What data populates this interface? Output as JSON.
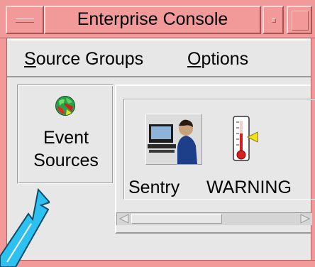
{
  "window": {
    "title": "Enterprise Console"
  },
  "menubar": {
    "items": [
      {
        "mnemonic": "S",
        "rest": "ource Groups"
      },
      {
        "mnemonic": "O",
        "rest": "ptions"
      }
    ]
  },
  "sidebar": {
    "event_sources": {
      "line1": "Event",
      "line2": "Sources",
      "icon": "globe-icon"
    }
  },
  "main": {
    "items": [
      {
        "label": "Sentry",
        "icon": "sentry-operator-icon"
      },
      {
        "label": "WARNING",
        "icon": "thermometer-warning-icon"
      }
    ]
  },
  "colors": {
    "titlebar": "#f29a9a",
    "background": "#e7e7e7",
    "cursor": "#2dc1f2"
  }
}
